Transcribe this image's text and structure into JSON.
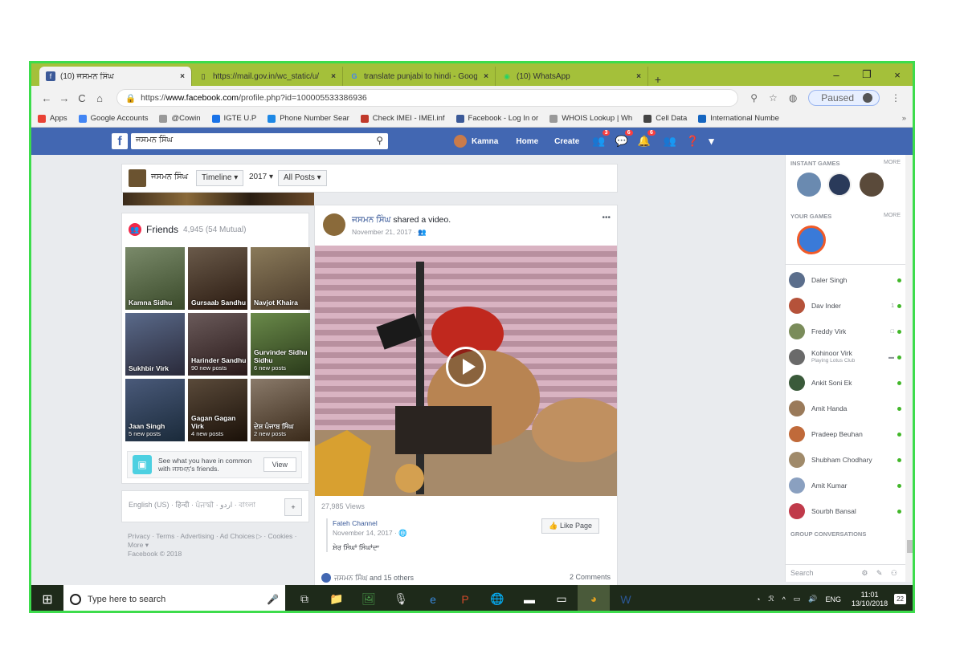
{
  "tabs": [
    {
      "icon": "f",
      "icon_color": "#3b5998",
      "label": "(10) ਜਸਮਨ ਸਿੰਘ",
      "close": "×",
      "active": true
    },
    {
      "icon": "▯",
      "icon_color": "#666",
      "label": "https://mail.gov.in/wc_static/u/",
      "close": "×",
      "active": false
    },
    {
      "icon": "G",
      "icon_color": "#4285f4",
      "label": "translate punjabi to hindi - Goog",
      "close": "×",
      "active": false
    },
    {
      "icon": "◉",
      "icon_color": "#25d366",
      "label": "(10) WhatsApp",
      "close": "×",
      "active": false
    }
  ],
  "newtab": "+",
  "window_controls": {
    "minimize": "–",
    "restore": "❐",
    "close": "×"
  },
  "nav": {
    "back": "←",
    "forward": "→",
    "reload": "C",
    "home": "⌂"
  },
  "url": {
    "lock": "🔒",
    "prefix": "https://",
    "host": "www.facebook.com",
    "path": "/profile.php?id=100005533386936"
  },
  "addr_icons": {
    "zoom": "⚲",
    "star": "☆",
    "ext": "◍",
    "paused": "Paused",
    "menu": "⋮"
  },
  "bookmarks": [
    {
      "label": "Apps",
      "color": "#e94235"
    },
    {
      "label": "Google Accounts",
      "color": "#4285f4"
    },
    {
      "label": "@Cowin",
      "color": "#999"
    },
    {
      "label": "IGTE U.P",
      "color": "#1a73e8"
    },
    {
      "label": "Phone Number Sear",
      "color": "#1e88e5"
    },
    {
      "label": "Check IMEI - IMEI.inf",
      "color": "#c0392b"
    },
    {
      "label": "Facebook - Log In or",
      "color": "#3b5998"
    },
    {
      "label": "WHOIS Lookup | Wh",
      "color": "#999"
    },
    {
      "label": "Cell Data",
      "color": "#444"
    },
    {
      "label": "International Numbe",
      "color": "#1565c0"
    }
  ],
  "bookmarks_more": "»",
  "fb": {
    "logo": "f",
    "search_value": "ਜਸਮਨ ਸਿੰਘ",
    "search_glyph": "⚲",
    "user": "Kamna",
    "home": "Home",
    "create": "Create",
    "badges": [
      "3",
      "6",
      "6"
    ],
    "icons": {
      "friends": "👥",
      "messenger": "💬",
      "notifications": "🔔",
      "requests": "👥",
      "help": "❓",
      "menu": "▾"
    }
  },
  "profile": {
    "name": "ਜਸਮਨ ਸਿੰਘ",
    "timeline": "Timeline ▾",
    "year": "2017 ▾",
    "posts": "All Posts ▾"
  },
  "friends": {
    "title": "Friends",
    "count": "4,945 (54 Mutual)",
    "items": [
      {
        "name": "Kamna Sidhu",
        "sub": ""
      },
      {
        "name": "Gursaab Sandhu",
        "sub": ""
      },
      {
        "name": "Navjot Khaira",
        "sub": ""
      },
      {
        "name": "Sukhbir Virk",
        "sub": ""
      },
      {
        "name": "Harinder Sandhu",
        "sub": "90 new posts"
      },
      {
        "name": "Gurvinder Sidhu Sidhu",
        "sub": "6 new posts"
      },
      {
        "name": "Jaan Singh",
        "sub": "5 new posts"
      },
      {
        "name": "Gagan Gagan Virk",
        "sub": "4 new posts"
      },
      {
        "name": "ਦੇਸ਼ ਪੰਜਾਬ ਸਿੰਘ",
        "sub": "2 new posts"
      }
    ],
    "common_text": "See what you have in common with ਜਸਮਨ's friends.",
    "view": "View"
  },
  "languages": "English (US) · हिन्दी · ਪੰਜਾਬੀ · اردو · বাংলা",
  "lang_plus": "+",
  "footer": {
    "links": "Privacy · Terms · Advertising · Ad Choices ▷ · Cookies · More ▾",
    "copyright": "Facebook © 2018"
  },
  "post": {
    "author": "ਜਸਮਨ ਸਿੰਘ",
    "action": "shared a video.",
    "date": "November 21, 2017 · 👥",
    "dots": "•••",
    "views": "27,985 Views",
    "source": "Fateh Channel",
    "source_date": "November 14, 2017 · 🌐",
    "source_text": "ਸ਼ੇਰ ਸਿੰਘਾਂ ਸਿੰਘਾਂਦਾ",
    "like_page": "👍 Like Page",
    "reactions": "ਜਸਮਨ ਸਿੰਘ and 15 others",
    "comments": "2 Comments"
  },
  "sidebar": {
    "instant_games": "INSTANT GAMES",
    "your_games": "YOUR GAMES",
    "more": "MORE",
    "contacts": [
      {
        "name": "Daler Singh",
        "sub": "",
        "extra": "",
        "color": "#5b6e8c"
      },
      {
        "name": "Dav Inder",
        "sub": "",
        "extra": "1",
        "color": "#b5523a"
      },
      {
        "name": "Freddy Virk",
        "sub": "",
        "extra": "□",
        "color": "#7a8c5a"
      },
      {
        "name": "Kohinoor Virk",
        "sub": "Playing Lotus Club",
        "extra": "▬",
        "color": "#6a6a6a"
      },
      {
        "name": "Ankit Soni Ek",
        "sub": "",
        "extra": "",
        "color": "#3a5a3a"
      },
      {
        "name": "Amit Handa",
        "sub": "",
        "extra": "",
        "color": "#9a7a5a"
      },
      {
        "name": "Pradeep Beuhan",
        "sub": "",
        "extra": "",
        "color": "#c06a3a"
      },
      {
        "name": "Shubham Chodhary",
        "sub": "",
        "extra": "",
        "color": "#a08a6a"
      },
      {
        "name": "Amit Kumar",
        "sub": "",
        "extra": "",
        "color": "#8aa0c0"
      },
      {
        "name": "Sourbh Bansal",
        "sub": "",
        "extra": "",
        "color": "#c03a4a"
      }
    ],
    "group_conversations": "GROUP CONVERSATIONS",
    "search": "Search",
    "search_icons": "⚙ ✎ ⚇"
  },
  "taskbar": {
    "start": "⊞",
    "search": "Type here to search",
    "mic": "🎤",
    "apps": [
      "⧉",
      "📁",
      "🖼",
      "🎙",
      "e",
      "P",
      "🌐",
      "▬",
      "▭",
      "◕",
      "W"
    ],
    "tray": [
      "◔",
      "ℛ",
      "^",
      "▭",
      "🔊",
      "ENG"
    ],
    "time": "11:01",
    "date": "13/10/2018",
    "notif": "22"
  }
}
